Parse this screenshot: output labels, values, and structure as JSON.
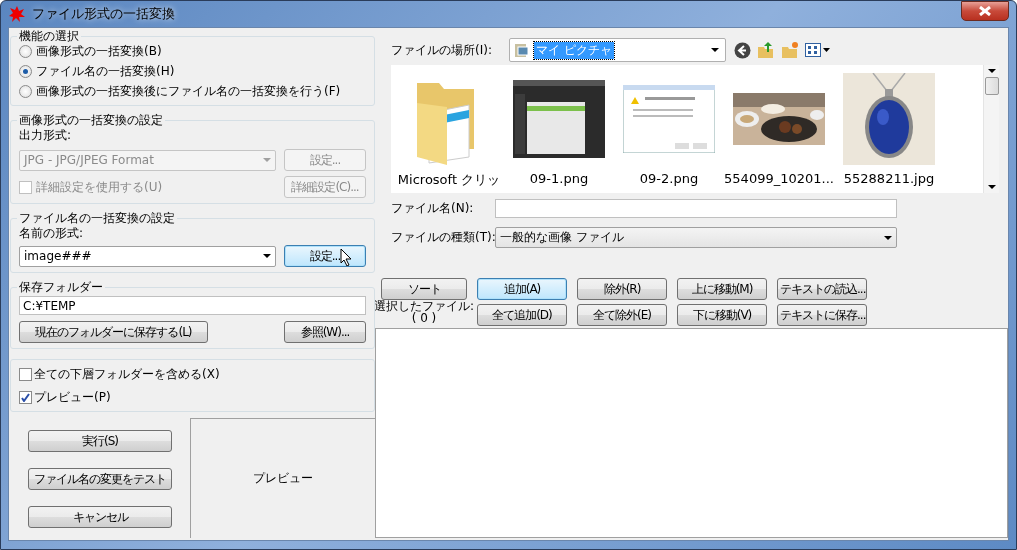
{
  "window": {
    "title": "ファイル形式の一括変換"
  },
  "function_group": {
    "title": "機能の選択",
    "options": [
      {
        "label": "画像形式の一括変換(B)",
        "selected": false
      },
      {
        "label": "ファイル名の一括変換(H)",
        "selected": true
      },
      {
        "label": "画像形式の一括変換後にファイル名の一括変換を行う(F)",
        "selected": false
      }
    ]
  },
  "image_format_group": {
    "title": "画像形式の一括変換の設定",
    "output_label": "出力形式:",
    "format_select": {
      "value": "JPG - JPG/JPEG Format",
      "disabled": true
    },
    "settings_button": {
      "label": "設定...",
      "disabled": true
    },
    "detail_checkbox": {
      "label": "詳細設定を使用する(U)",
      "checked": false,
      "disabled": true
    },
    "detail_button": {
      "label": "詳細設定(C)...",
      "disabled": true
    }
  },
  "filename_group": {
    "title": "ファイル名の一括変換の設定",
    "name_label": "名前の形式:",
    "name_select": {
      "value": "image###"
    },
    "settings_button": {
      "label": "設定...",
      "hovered": true
    }
  },
  "save_folder_group": {
    "title": "保存フォルダー",
    "path": "C:¥TEMP",
    "current_button": "現在のフォルダーに保存する(L)",
    "browse_button": "参照(W)..."
  },
  "options": [
    {
      "label": "全ての下層フォルダーを含める(X)",
      "checked": false
    },
    {
      "label": "プレビュー(P)",
      "checked": true
    }
  ],
  "actions": [
    "実行(S)",
    "ファイル名の変更をテスト",
    "キャンセル"
  ],
  "preview": {
    "label": "プレビュー"
  },
  "browser": {
    "location_label": "ファイルの場所(I):",
    "location": "マイ ピクチャ",
    "files": [
      {
        "name": "Microsoft クリッ",
        "kind": "folder"
      },
      {
        "name": "09-1.png",
        "kind": "dark-screenshot"
      },
      {
        "name": "09-2.png",
        "kind": "dialog-screenshot"
      },
      {
        "name": "554099_10201...",
        "kind": "food-photo"
      },
      {
        "name": "55288211.jpg",
        "kind": "pendant-photo"
      }
    ],
    "filename_label": "ファイル名(N):",
    "filetype_label": "ファイルの種類(T):",
    "filetype": "一般的な画像 ファイル"
  },
  "list_buttons": [
    {
      "label": "ソート",
      "focused": false
    },
    {
      "label": "追加(A)",
      "focused": true
    },
    {
      "label": "除外(R)",
      "focused": false
    },
    {
      "label": "上に移動(M)",
      "focused": false
    },
    {
      "label": "テキストの読込...",
      "focused": false
    },
    {
      "label": "全て追加(D)",
      "focused": false
    },
    {
      "label": "全て除外(E)",
      "focused": false
    },
    {
      "label": "下に移動(V)",
      "focused": false
    },
    {
      "label": "テキストに保存...",
      "focused": false
    }
  ],
  "selected_files": {
    "label": "選択したファイル:",
    "count": "( 0 )"
  }
}
